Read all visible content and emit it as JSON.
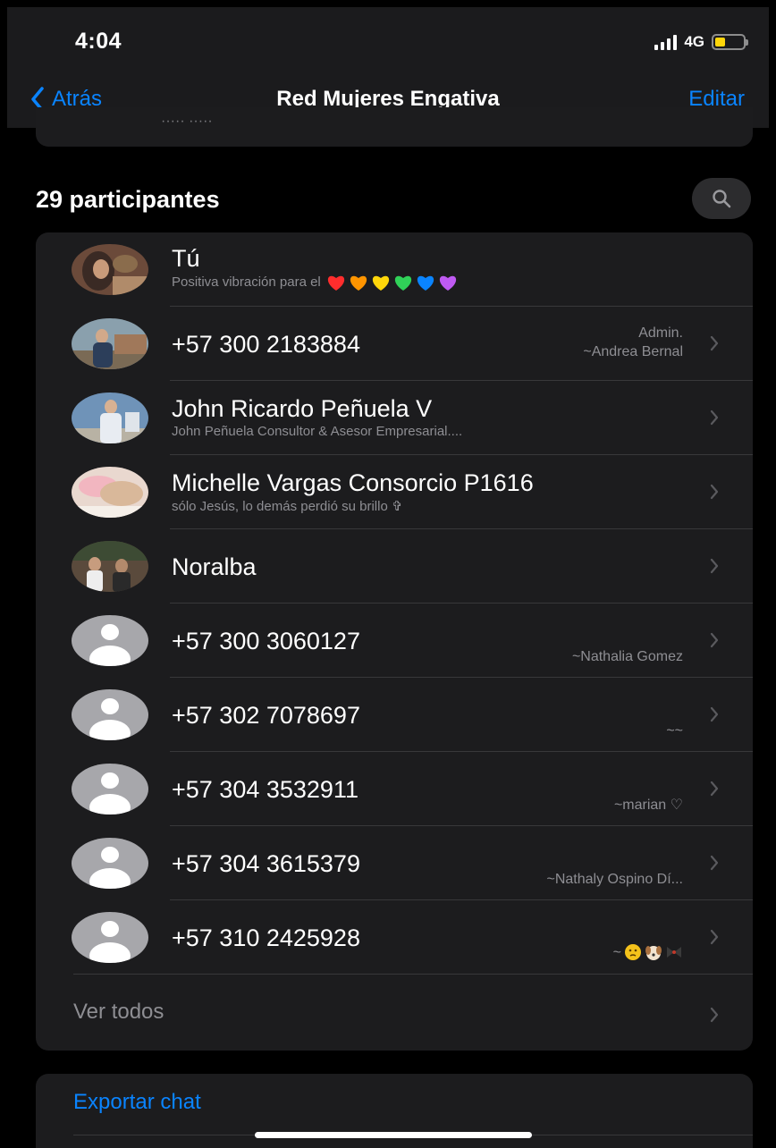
{
  "status_bar": {
    "time": "4:04",
    "network": "4G",
    "battery_level": 0.35,
    "battery_color": "#ffd60a"
  },
  "nav": {
    "back_label": "Atrás",
    "title": "Red Mujeres Engativa",
    "edit_label": "Editar"
  },
  "participants": {
    "header": "29 participantes",
    "rows": [
      {
        "name": "Tú",
        "status": "Positiva vibración para el",
        "status_icons": [
          "red-heart",
          "orange-heart",
          "yellow-heart",
          "green-heart",
          "blue-heart",
          "purple-heart"
        ],
        "meta": "",
        "meta2": "",
        "avatar": "photo"
      },
      {
        "name": "+57 300 2183884",
        "status": "",
        "meta": "Admin.",
        "meta2": "~Andrea Bernal",
        "avatar": "photo"
      },
      {
        "name": "John Ricardo Peñuela V",
        "status": "John Peñuela Consultor & Asesor Empresarial....",
        "meta": "",
        "meta2": "",
        "avatar": "photo"
      },
      {
        "name": "Michelle Vargas Consorcio P1616",
        "status": "sólo Jesús, lo demás perdió su brillo ✞",
        "meta": "",
        "meta2": "",
        "avatar": "photo"
      },
      {
        "name": "Noralba",
        "status": "",
        "meta": "",
        "meta2": "",
        "avatar": "photo"
      },
      {
        "name": "+57 300 3060127",
        "status": "",
        "meta": "",
        "meta2": "~Nathalia Gomez",
        "avatar": "default"
      },
      {
        "name": "+57 302 7078697",
        "status": "",
        "meta": "",
        "meta2": "~~",
        "avatar": "default"
      },
      {
        "name": "+57 304 3532911",
        "status": "",
        "meta": "",
        "meta2": "~marian ♡",
        "avatar": "default"
      },
      {
        "name": "+57 304 3615379",
        "status": "",
        "meta": "",
        "meta2": "~Nathaly Ospino Dí...",
        "avatar": "default"
      },
      {
        "name": "+57 310 2425928",
        "status": "",
        "meta": "",
        "meta2": "~",
        "meta2_icons": [
          "thinking-face-icon",
          "dog-face-icon",
          "bow-icon"
        ],
        "avatar": "default"
      }
    ],
    "view_all_label": "Ver todos"
  },
  "export": {
    "label": "Exportar chat"
  },
  "colors": {
    "accent": "#0a84ff",
    "card": "#1c1c1e",
    "secondary_text": "#8e8e93"
  }
}
